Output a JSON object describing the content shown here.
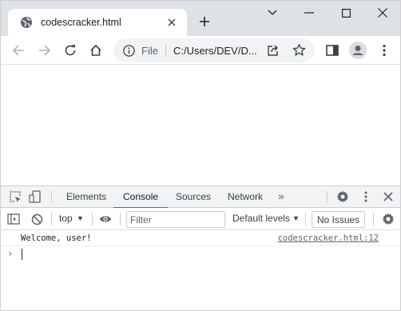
{
  "tab": {
    "title": "codescracker.html"
  },
  "omnibox": {
    "chip": "File",
    "url": "C:/Users/DEV/D..."
  },
  "devtools": {
    "tabs": [
      "Elements",
      "Console",
      "Sources",
      "Network"
    ],
    "active_tab": "Console"
  },
  "console_bar": {
    "context": "top",
    "filter_placeholder": "Filter",
    "levels": "Default levels",
    "issues": "No Issues"
  },
  "log": [
    {
      "message": "Welcome, user!",
      "source": "codescracker.html:12"
    }
  ],
  "icons": {
    "favicon": "globe-icon",
    "tab_close": "close-icon",
    "new_tab": "plus-icon",
    "tab_search": "chevron-down-icon",
    "minimize": "minimize-icon",
    "maximize": "maximize-icon",
    "close_window": "close-window-icon",
    "back": "back-arrow-icon",
    "forward": "forward-arrow-icon",
    "reload": "reload-icon",
    "home": "home-icon",
    "site_info": "info-icon",
    "share": "share-icon",
    "bookmark": "star-icon",
    "side_panel": "side-panel-icon",
    "profile": "avatar-icon",
    "menu": "kebab-menu-icon"
  },
  "colors": {
    "accent": "#1a73e8",
    "tabstrip": "#dee1e6",
    "omnibox": "#f1f3f4"
  }
}
